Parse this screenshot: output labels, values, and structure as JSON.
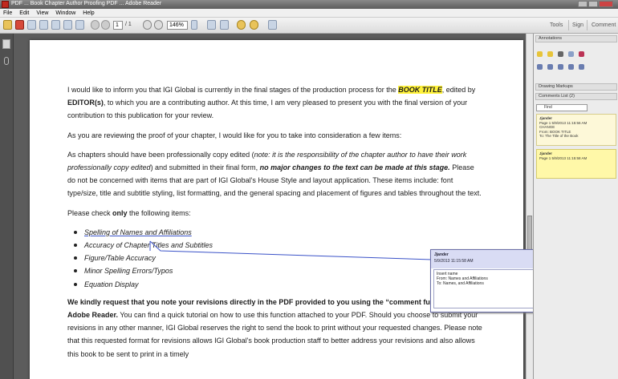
{
  "window": {
    "title": "PDF ... Book Chapter Author Proofing PDF ... Adobe Reader"
  },
  "menu": [
    "File",
    "Edit",
    "View",
    "Window",
    "Help"
  ],
  "toolbar": {
    "page_current": "1",
    "page_total": "/ 1",
    "zoom": "146%",
    "tools_label": "Tools",
    "sign_label": "Sign",
    "comment_label": "Comment"
  },
  "document": {
    "para1": {
      "prefix": "I would like to inform you that IGI Global is currently in the final stages of the production process for the",
      "book_title": "BOOK TITLE",
      "mid1": ", edited by ",
      "editors": "EDITOR(s)",
      "suffix": ", to which you are a contributing author.  At this time, I am very pleased to present you with the final version of your contribution to this publication for your review."
    },
    "para2": "As you are reviewing the proof of your chapter, I would like for you to take into consideration a few items:",
    "para3": {
      "lead": "As chapters should have been professionally copy edited (",
      "note_italic": "note: it is the responsibility of the chapter author to have their work professionally copy edited",
      "mid": ") and submitted in their final form, ",
      "bold_italic": "no major changes to the text can be made at this stage.",
      "rest": "  Please do not be concerned with items that are part of IGI Global's House Style and layout application. These items include: font type/size, title and subtitle styling, list formatting, and the general spacing and placement of figures and tables throughout the text."
    },
    "para4": {
      "pre": "Please check ",
      "bold": "only",
      "post": " the following items:"
    },
    "list": [
      "Spelling of Names and Affiliations",
      "Accuracy of Chapter Titles and Subtitles",
      "Figure/Table Accuracy",
      "Minor Spelling Errors/Typos",
      "Equation Display"
    ],
    "para5": {
      "bold": "We kindly request that you note your revisions directly in the PDF provided to you using the “comment function” in Adobe Reader.",
      "rest": " You can find a quick tutorial on how to use this function attached to your PDF.  Should you choose to submit your revisions in any other manner, IGI Global reserves the right to send the book to print without your requested changes. Please note that this requested format for revisions allows IGI Global's book production staff to better address your revisions and also allows this book to be sent to print in a timely"
    }
  },
  "sticky_note": {
    "author": "Jjander",
    "date": "5/9/2013 11:15:58 AM",
    "text_lines": [
      "Insert name",
      "From: Names and Affiliations",
      "To: Names, and Affiliations"
    ]
  },
  "right_panel": {
    "annotations_header": "Annotations",
    "drawing_header": "Drawing Markups",
    "comments_header": "Comments List (2)",
    "find_placeholder": "Find",
    "comment1": {
      "author": "Jjander",
      "date": "Page 1  5/9/2013 11:15:56 AM",
      "lines": [
        "CHANGE",
        "From: BOOK TITLE",
        "To: The Title of the Book"
      ]
    },
    "comment2": {
      "author": "Jjander",
      "date": "Page 1  5/9/2013 11:15:58 AM"
    }
  },
  "colors": {
    "highlight": "#fff23a",
    "note_header": "#d9dcf4",
    "comment_bg": "#fff8a8"
  }
}
